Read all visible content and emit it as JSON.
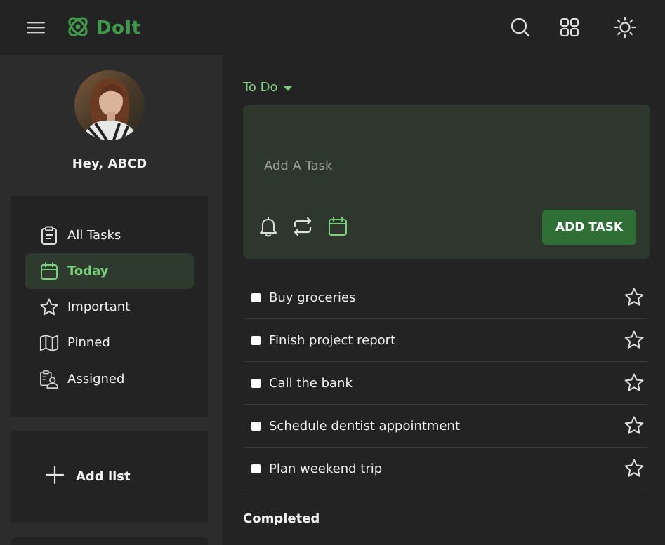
{
  "header": {
    "app_name": "DoIt",
    "brand_color": "#3e9a4a",
    "icons": [
      "menu-icon",
      "logo-icon",
      "search-icon",
      "grid-icon",
      "sun-icon"
    ]
  },
  "sidebar": {
    "greeting": "Hey, ABCD",
    "items": [
      {
        "label": "All Tasks",
        "icon": "clipboard-icon",
        "active": false
      },
      {
        "label": "Today",
        "icon": "calendar-icon",
        "active": true
      },
      {
        "label": "Important",
        "icon": "star-icon",
        "active": false
      },
      {
        "label": "Pinned",
        "icon": "map-icon",
        "active": false
      },
      {
        "label": "Assigned",
        "icon": "assigned-icon",
        "active": false
      }
    ],
    "add_list_label": "Add list"
  },
  "main": {
    "section_title": "To Do",
    "add_task": {
      "placeholder": "Add A Task",
      "button_label": "ADD TASK",
      "tools": [
        "bell-icon",
        "repeat-icon",
        "calendar-icon"
      ]
    },
    "tasks": [
      {
        "text": "Buy groceries",
        "checked": false,
        "starred": false
      },
      {
        "text": "Finish project report",
        "checked": false,
        "starred": false
      },
      {
        "text": "Call the bank",
        "checked": false,
        "starred": false
      },
      {
        "text": "Schedule dentist appointment",
        "checked": false,
        "starred": false
      },
      {
        "text": "Plan weekend trip",
        "checked": false,
        "starred": false
      }
    ],
    "completed_label": "Completed"
  },
  "colors": {
    "accent": "#7ccf7c",
    "button": "#2f6f36",
    "background": "#232323",
    "sidebar": "#2c2c2c"
  }
}
